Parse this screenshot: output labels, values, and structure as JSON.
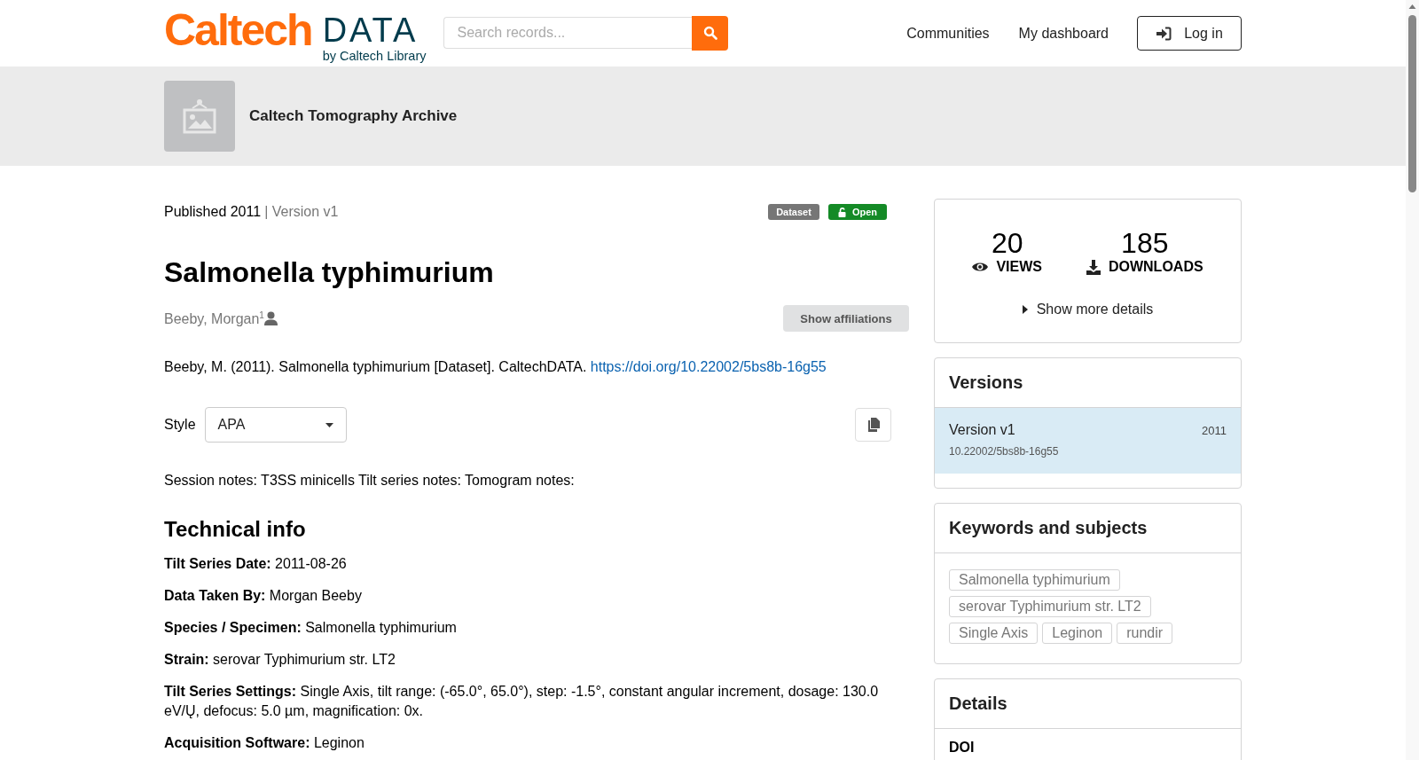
{
  "header": {
    "logo_main": "Caltech",
    "logo_sub": "DATA",
    "logo_tagline": "by Caltech Library",
    "search": {
      "placeholder": "Search records..."
    },
    "nav": [
      "Communities",
      "My dashboard"
    ],
    "login_button": "Log in"
  },
  "community": {
    "name": "Caltech Tomography Archive"
  },
  "record": {
    "published": "Published 2011",
    "version": "| Version v1",
    "badges": [
      {
        "label": "Dataset",
        "kind": "type"
      },
      {
        "label": "Open",
        "kind": "access"
      }
    ],
    "title": "Salmonella typhimurium",
    "authors": [
      {
        "name": "Beeby, Morgan",
        "affiliation_mark": "1"
      }
    ],
    "affiliations_button": "Show affiliations",
    "citation": {
      "text": "Beeby, M. (2011). Salmonella typhimurium [Dataset]. CaltechDATA.",
      "link": "https://doi.org/10.22002/5bs8b-16g55"
    },
    "style": {
      "label": "Style",
      "value": "APA"
    },
    "description": "Session notes: T3SS minicells Tilt series notes: Tomogram notes:",
    "technical": {
      "heading": "Technical info",
      "fields": [
        "**Tilt Series Date:** 2011-08-26",
        "**Data Taken By:** Morgan Beeby",
        "**Species / Specimen:** Salmonella typhimurium",
        "**Strain:** serovar Typhimurium str. LT2",
        "**Tilt Series Settings:** Single Axis, tilt range: (-65.0°, 65.0°), step: -1.5°, constant angular increment, dosage: 130.0 eV/Ų, defocus: 5.0 µm, magnification: 0x.",
        "**Acquisition Software:** Leginon"
      ]
    }
  },
  "sidebar": {
    "stats": [
      {
        "count": "20",
        "label": "VIEWS",
        "kind": "views"
      },
      {
        "count": "185",
        "label": "DOWNLOADS",
        "kind": "downloads"
      }
    ],
    "more_details": "Show more details",
    "versions": {
      "heading": "Versions",
      "items": [
        {
          "title": "Version v1",
          "year": "2011",
          "doi": "10.22002/5bs8b-16g55",
          "selected": true
        }
      ]
    },
    "keywords": {
      "heading": "Keywords and subjects",
      "tags": [
        "Salmonella typhimurium",
        "serovar Typhimurium str. LT2",
        "Single Axis",
        "Leginon",
        "rundir"
      ]
    },
    "details": {
      "heading": "Details",
      "fields": [
        {
          "label": "DOI"
        }
      ]
    }
  }
}
